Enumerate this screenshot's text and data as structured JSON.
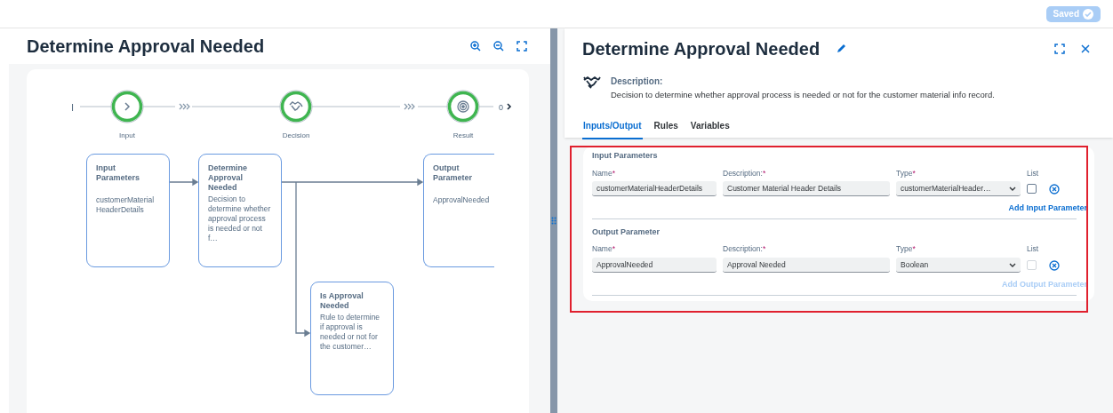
{
  "top_bar": {
    "save_status": "Saved"
  },
  "diagram_panel": {
    "title": "Determine Approval Needed",
    "flow": {
      "start_marker": "I",
      "end_marker": "0",
      "steps": [
        {
          "label": "Input",
          "kind": "input"
        },
        {
          "label": "Decision",
          "kind": "decision"
        },
        {
          "label": "Result",
          "kind": "result"
        }
      ]
    },
    "nodes": [
      {
        "title": "Input Parameters",
        "text": "customerMaterial HeaderDetails",
        "kind": "input"
      },
      {
        "title": "Determine Approval Needed",
        "text": "Decision to determine whether approval process is needed or not f…",
        "kind": "decision"
      },
      {
        "title": "Output Parameter",
        "text": "ApprovalNeeded",
        "kind": "output"
      },
      {
        "title": "Is Approval Needed",
        "text": "Rule to determine if approval is needed or not for the customer…",
        "kind": "rule"
      }
    ]
  },
  "detail_panel": {
    "title": "Determine Approval Needed",
    "description_label": "Description:",
    "description": "Decision to determine whether approval process is needed or not for the customer material info record.",
    "tabs": [
      {
        "label": "Inputs/Output",
        "selected": true
      },
      {
        "label": "Rules",
        "selected": false
      },
      {
        "label": "Variables",
        "selected": false
      }
    ],
    "sections": [
      {
        "heading": "Input Parameters",
        "columns": [
          {
            "label": "Name",
            "required_mark": "*"
          },
          {
            "label": "Description:",
            "required_mark": "*"
          },
          {
            "label": "Type",
            "required_mark": "*"
          },
          {
            "label": "List"
          }
        ],
        "rows": [
          {
            "name": "customerMaterialHeaderDetails",
            "description": "Customer Material Header Details",
            "type": "customerMaterialHeader…",
            "list_checked": false,
            "list_disabled": false
          }
        ],
        "add_link": {
          "label": "Add Input Parameter",
          "disabled": false
        }
      },
      {
        "heading": "Output Parameter",
        "columns": [
          {
            "label": "Name",
            "required_mark": "*"
          },
          {
            "label": "Description:",
            "required_mark": "*"
          },
          {
            "label": "Type",
            "required_mark": "*"
          },
          {
            "label": "List"
          }
        ],
        "rows": [
          {
            "name": "ApprovalNeeded",
            "description": "Approval Needed",
            "type": "Boolean",
            "list_checked": false,
            "list_disabled": true
          }
        ],
        "add_link": {
          "label": "Add Output Parameter",
          "disabled": true
        }
      }
    ]
  }
}
